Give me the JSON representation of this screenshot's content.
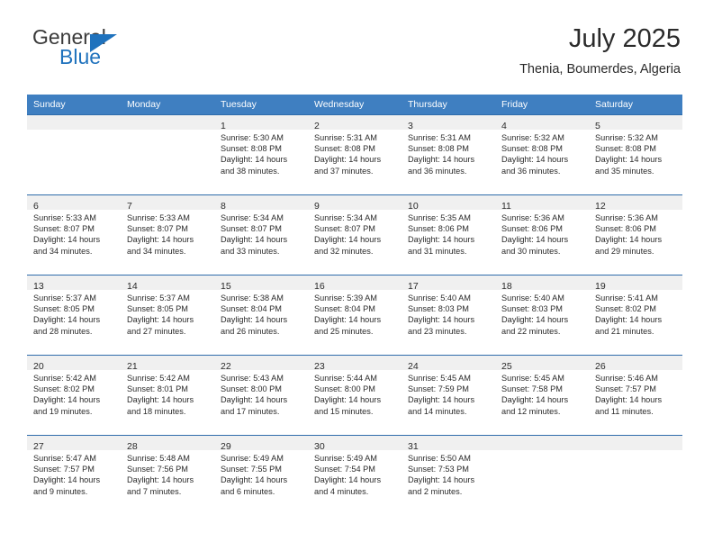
{
  "brand": {
    "name_top": "General",
    "name_bottom": "Blue",
    "flag_color": "#1f72bd",
    "text_color": "#3a3a3a"
  },
  "header": {
    "title": "July 2025",
    "subtitle": "Thenia, Boumerdes, Algeria"
  },
  "theme": {
    "header_bg": "#3f7fc1",
    "row_rule": "#2f6cab",
    "daynum_bg": "#f0f0f0"
  },
  "weekdays": [
    "Sunday",
    "Monday",
    "Tuesday",
    "Wednesday",
    "Thursday",
    "Friday",
    "Saturday"
  ],
  "weeks": [
    [
      {
        "day": "",
        "sunrise": "",
        "sunset": "",
        "daylight1": "",
        "daylight2": ""
      },
      {
        "day": "",
        "sunrise": "",
        "sunset": "",
        "daylight1": "",
        "daylight2": ""
      },
      {
        "day": "1",
        "sunrise": "Sunrise: 5:30 AM",
        "sunset": "Sunset: 8:08 PM",
        "daylight1": "Daylight: 14 hours",
        "daylight2": "and 38 minutes."
      },
      {
        "day": "2",
        "sunrise": "Sunrise: 5:31 AM",
        "sunset": "Sunset: 8:08 PM",
        "daylight1": "Daylight: 14 hours",
        "daylight2": "and 37 minutes."
      },
      {
        "day": "3",
        "sunrise": "Sunrise: 5:31 AM",
        "sunset": "Sunset: 8:08 PM",
        "daylight1": "Daylight: 14 hours",
        "daylight2": "and 36 minutes."
      },
      {
        "day": "4",
        "sunrise": "Sunrise: 5:32 AM",
        "sunset": "Sunset: 8:08 PM",
        "daylight1": "Daylight: 14 hours",
        "daylight2": "and 36 minutes."
      },
      {
        "day": "5",
        "sunrise": "Sunrise: 5:32 AM",
        "sunset": "Sunset: 8:08 PM",
        "daylight1": "Daylight: 14 hours",
        "daylight2": "and 35 minutes."
      }
    ],
    [
      {
        "day": "6",
        "sunrise": "Sunrise: 5:33 AM",
        "sunset": "Sunset: 8:07 PM",
        "daylight1": "Daylight: 14 hours",
        "daylight2": "and 34 minutes."
      },
      {
        "day": "7",
        "sunrise": "Sunrise: 5:33 AM",
        "sunset": "Sunset: 8:07 PM",
        "daylight1": "Daylight: 14 hours",
        "daylight2": "and 34 minutes."
      },
      {
        "day": "8",
        "sunrise": "Sunrise: 5:34 AM",
        "sunset": "Sunset: 8:07 PM",
        "daylight1": "Daylight: 14 hours",
        "daylight2": "and 33 minutes."
      },
      {
        "day": "9",
        "sunrise": "Sunrise: 5:34 AM",
        "sunset": "Sunset: 8:07 PM",
        "daylight1": "Daylight: 14 hours",
        "daylight2": "and 32 minutes."
      },
      {
        "day": "10",
        "sunrise": "Sunrise: 5:35 AM",
        "sunset": "Sunset: 8:06 PM",
        "daylight1": "Daylight: 14 hours",
        "daylight2": "and 31 minutes."
      },
      {
        "day": "11",
        "sunrise": "Sunrise: 5:36 AM",
        "sunset": "Sunset: 8:06 PM",
        "daylight1": "Daylight: 14 hours",
        "daylight2": "and 30 minutes."
      },
      {
        "day": "12",
        "sunrise": "Sunrise: 5:36 AM",
        "sunset": "Sunset: 8:06 PM",
        "daylight1": "Daylight: 14 hours",
        "daylight2": "and 29 minutes."
      }
    ],
    [
      {
        "day": "13",
        "sunrise": "Sunrise: 5:37 AM",
        "sunset": "Sunset: 8:05 PM",
        "daylight1": "Daylight: 14 hours",
        "daylight2": "and 28 minutes."
      },
      {
        "day": "14",
        "sunrise": "Sunrise: 5:37 AM",
        "sunset": "Sunset: 8:05 PM",
        "daylight1": "Daylight: 14 hours",
        "daylight2": "and 27 minutes."
      },
      {
        "day": "15",
        "sunrise": "Sunrise: 5:38 AM",
        "sunset": "Sunset: 8:04 PM",
        "daylight1": "Daylight: 14 hours",
        "daylight2": "and 26 minutes."
      },
      {
        "day": "16",
        "sunrise": "Sunrise: 5:39 AM",
        "sunset": "Sunset: 8:04 PM",
        "daylight1": "Daylight: 14 hours",
        "daylight2": "and 25 minutes."
      },
      {
        "day": "17",
        "sunrise": "Sunrise: 5:40 AM",
        "sunset": "Sunset: 8:03 PM",
        "daylight1": "Daylight: 14 hours",
        "daylight2": "and 23 minutes."
      },
      {
        "day": "18",
        "sunrise": "Sunrise: 5:40 AM",
        "sunset": "Sunset: 8:03 PM",
        "daylight1": "Daylight: 14 hours",
        "daylight2": "and 22 minutes."
      },
      {
        "day": "19",
        "sunrise": "Sunrise: 5:41 AM",
        "sunset": "Sunset: 8:02 PM",
        "daylight1": "Daylight: 14 hours",
        "daylight2": "and 21 minutes."
      }
    ],
    [
      {
        "day": "20",
        "sunrise": "Sunrise: 5:42 AM",
        "sunset": "Sunset: 8:02 PM",
        "daylight1": "Daylight: 14 hours",
        "daylight2": "and 19 minutes."
      },
      {
        "day": "21",
        "sunrise": "Sunrise: 5:42 AM",
        "sunset": "Sunset: 8:01 PM",
        "daylight1": "Daylight: 14 hours",
        "daylight2": "and 18 minutes."
      },
      {
        "day": "22",
        "sunrise": "Sunrise: 5:43 AM",
        "sunset": "Sunset: 8:00 PM",
        "daylight1": "Daylight: 14 hours",
        "daylight2": "and 17 minutes."
      },
      {
        "day": "23",
        "sunrise": "Sunrise: 5:44 AM",
        "sunset": "Sunset: 8:00 PM",
        "daylight1": "Daylight: 14 hours",
        "daylight2": "and 15 minutes."
      },
      {
        "day": "24",
        "sunrise": "Sunrise: 5:45 AM",
        "sunset": "Sunset: 7:59 PM",
        "daylight1": "Daylight: 14 hours",
        "daylight2": "and 14 minutes."
      },
      {
        "day": "25",
        "sunrise": "Sunrise: 5:45 AM",
        "sunset": "Sunset: 7:58 PM",
        "daylight1": "Daylight: 14 hours",
        "daylight2": "and 12 minutes."
      },
      {
        "day": "26",
        "sunrise": "Sunrise: 5:46 AM",
        "sunset": "Sunset: 7:57 PM",
        "daylight1": "Daylight: 14 hours",
        "daylight2": "and 11 minutes."
      }
    ],
    [
      {
        "day": "27",
        "sunrise": "Sunrise: 5:47 AM",
        "sunset": "Sunset: 7:57 PM",
        "daylight1": "Daylight: 14 hours",
        "daylight2": "and 9 minutes."
      },
      {
        "day": "28",
        "sunrise": "Sunrise: 5:48 AM",
        "sunset": "Sunset: 7:56 PM",
        "daylight1": "Daylight: 14 hours",
        "daylight2": "and 7 minutes."
      },
      {
        "day": "29",
        "sunrise": "Sunrise: 5:49 AM",
        "sunset": "Sunset: 7:55 PM",
        "daylight1": "Daylight: 14 hours",
        "daylight2": "and 6 minutes."
      },
      {
        "day": "30",
        "sunrise": "Sunrise: 5:49 AM",
        "sunset": "Sunset: 7:54 PM",
        "daylight1": "Daylight: 14 hours",
        "daylight2": "and 4 minutes."
      },
      {
        "day": "31",
        "sunrise": "Sunrise: 5:50 AM",
        "sunset": "Sunset: 7:53 PM",
        "daylight1": "Daylight: 14 hours",
        "daylight2": "and 2 minutes."
      },
      {
        "day": "",
        "sunrise": "",
        "sunset": "",
        "daylight1": "",
        "daylight2": ""
      },
      {
        "day": "",
        "sunrise": "",
        "sunset": "",
        "daylight1": "",
        "daylight2": ""
      }
    ]
  ]
}
